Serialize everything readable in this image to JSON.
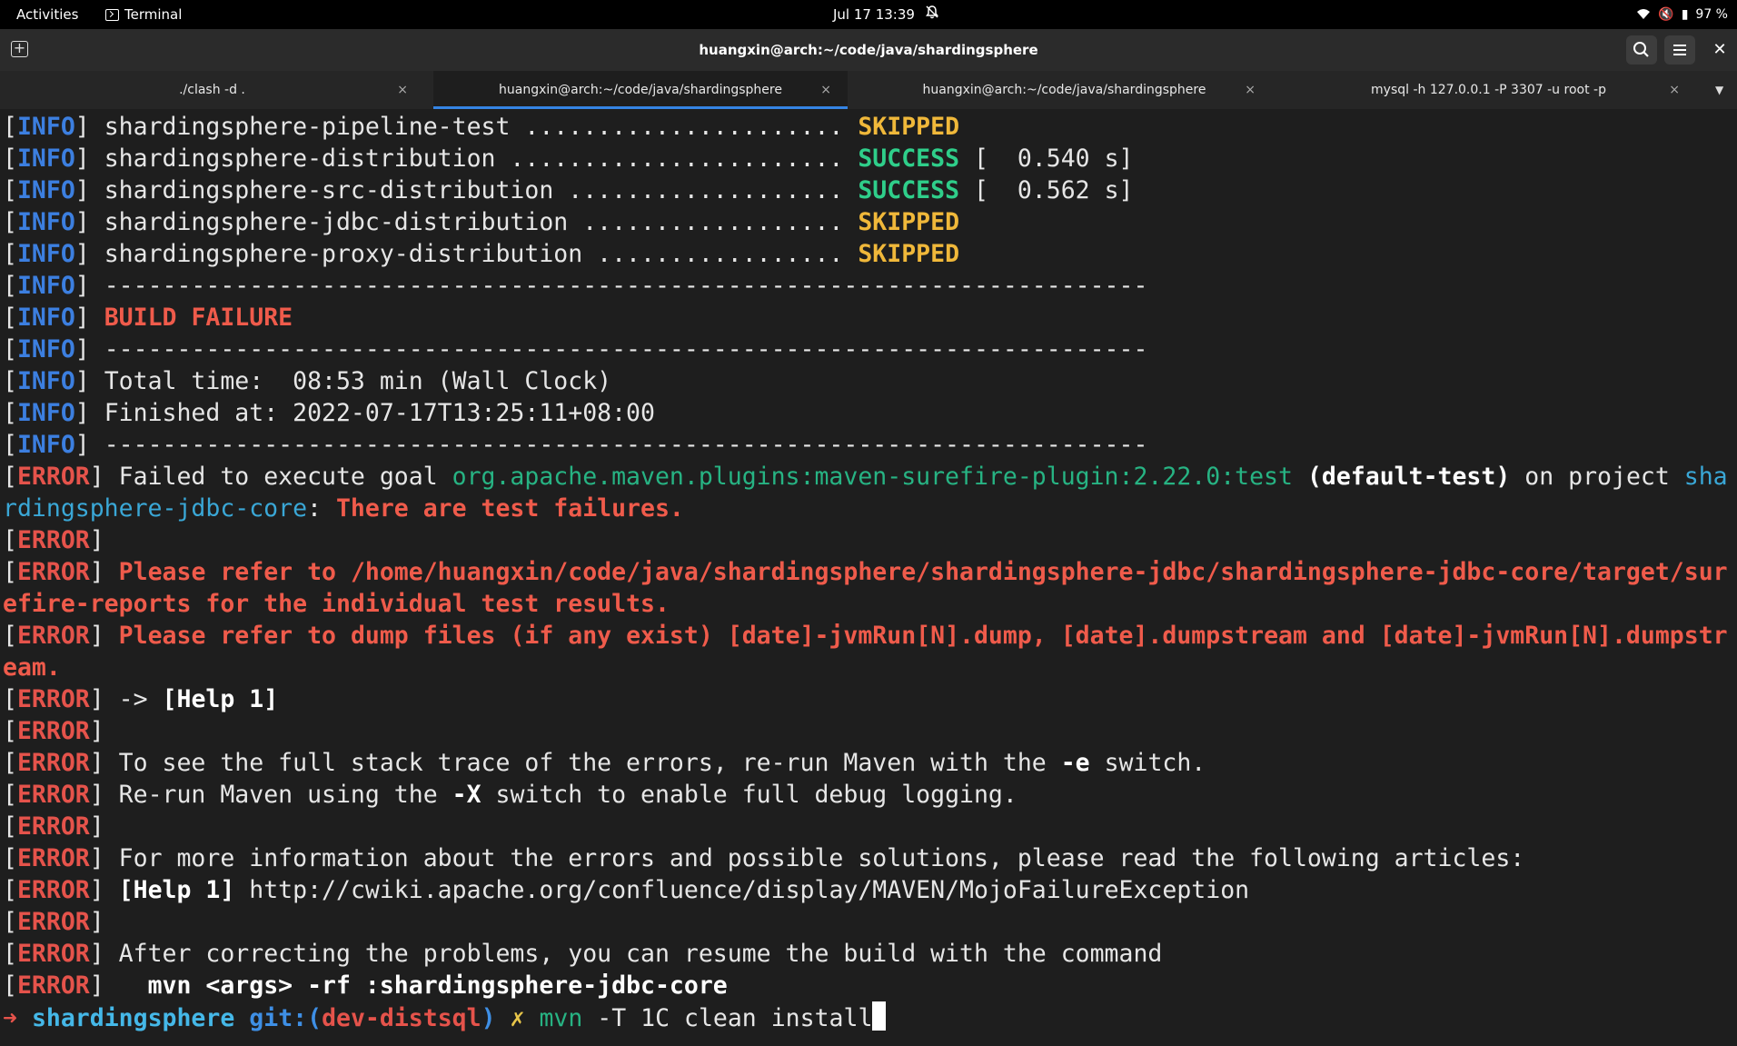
{
  "topbar": {
    "activities": "Activities",
    "app_name": "Terminal",
    "datetime": "Jul 17  13:39",
    "battery": "97 %"
  },
  "window": {
    "title": "huangxin@arch:~/code/java/shardingsphere"
  },
  "tabs": [
    {
      "label": "./clash -d ."
    },
    {
      "label": "huangxin@arch:~/code/java/shardingsphere"
    },
    {
      "label": "huangxin@arch:~/code/java/shardingsphere"
    },
    {
      "label": "mysql -h 127.0.0.1 -P 3307 -u root -p"
    }
  ],
  "tab_close": "×",
  "colors": {
    "info": "#3c7fe0",
    "error": "#e5534b",
    "success": "#2fce8a",
    "skipped": "#f0b83a",
    "accent": "#3584e4"
  },
  "terminal": {
    "lines": [
      {
        "s": [
          {
            "t": "[",
            "c": "br"
          },
          {
            "t": "INFO",
            "c": "info"
          },
          {
            "t": "] shardingsphere-pipeline-test ...................... "
          },
          {
            "t": "SKIPPED",
            "c": "skip"
          }
        ]
      },
      {
        "s": [
          {
            "t": "[",
            "c": "br"
          },
          {
            "t": "INFO",
            "c": "info"
          },
          {
            "t": "] shardingsphere-distribution ....................... "
          },
          {
            "t": "SUCCESS",
            "c": "succ"
          },
          {
            "t": " [  0.540 s]"
          }
        ]
      },
      {
        "s": [
          {
            "t": "[",
            "c": "br"
          },
          {
            "t": "INFO",
            "c": "info"
          },
          {
            "t": "] shardingsphere-src-distribution ................... "
          },
          {
            "t": "SUCCESS",
            "c": "succ"
          },
          {
            "t": " [  0.562 s]"
          }
        ]
      },
      {
        "s": [
          {
            "t": "[",
            "c": "br"
          },
          {
            "t": "INFO",
            "c": "info"
          },
          {
            "t": "] shardingsphere-jdbc-distribution .................. "
          },
          {
            "t": "SKIPPED",
            "c": "skip"
          }
        ]
      },
      {
        "s": [
          {
            "t": "[",
            "c": "br"
          },
          {
            "t": "INFO",
            "c": "info"
          },
          {
            "t": "] shardingsphere-proxy-distribution ................. "
          },
          {
            "t": "SKIPPED",
            "c": "skip"
          }
        ]
      },
      {
        "s": [
          {
            "t": "[",
            "c": "br"
          },
          {
            "t": "INFO",
            "c": "info"
          },
          {
            "t": "] ------------------------------------------------------------------------"
          }
        ]
      },
      {
        "s": [
          {
            "t": "[",
            "c": "br"
          },
          {
            "t": "INFO",
            "c": "info"
          },
          {
            "t": "] "
          },
          {
            "t": "BUILD FAILURE",
            "c": "red"
          }
        ]
      },
      {
        "s": [
          {
            "t": "[",
            "c": "br"
          },
          {
            "t": "INFO",
            "c": "info"
          },
          {
            "t": "] ------------------------------------------------------------------------"
          }
        ]
      },
      {
        "s": [
          {
            "t": "[",
            "c": "br"
          },
          {
            "t": "INFO",
            "c": "info"
          },
          {
            "t": "] Total time:  08:53 min (Wall Clock)"
          }
        ]
      },
      {
        "s": [
          {
            "t": "[",
            "c": "br"
          },
          {
            "t": "INFO",
            "c": "info"
          },
          {
            "t": "] Finished at: 2022-07-17T13:25:11+08:00"
          }
        ]
      },
      {
        "s": [
          {
            "t": "[",
            "c": "br"
          },
          {
            "t": "INFO",
            "c": "info"
          },
          {
            "t": "] ------------------------------------------------------------------------"
          }
        ]
      },
      {
        "s": [
          {
            "t": "[",
            "c": "br"
          },
          {
            "t": "ERROR",
            "c": "err"
          },
          {
            "t": "] Failed to execute goal "
          },
          {
            "t": "org.apache.maven.plugins:maven-surefire-plugin:2.22.0:test",
            "c": "green"
          },
          {
            "t": " "
          },
          {
            "t": "(default-test)",
            "c": "white"
          },
          {
            "t": " on project "
          },
          {
            "t": "sha",
            "c": "cyan"
          }
        ]
      },
      {
        "s": [
          {
            "t": "rdingsphere-jdbc-core",
            "c": "cyan"
          },
          {
            "t": ": "
          },
          {
            "t": "There are test failures.",
            "c": "red"
          }
        ]
      },
      {
        "s": [
          {
            "t": "[",
            "c": "br"
          },
          {
            "t": "ERROR",
            "c": "err"
          },
          {
            "t": "]"
          }
        ]
      },
      {
        "s": [
          {
            "t": "[",
            "c": "br"
          },
          {
            "t": "ERROR",
            "c": "err"
          },
          {
            "t": "] "
          },
          {
            "t": "Please refer to /home/huangxin/code/java/shardingsphere/shardingsphere-jdbc/shardingsphere-jdbc-core/target/sur",
            "c": "red"
          }
        ]
      },
      {
        "s": [
          {
            "t": "efire-reports for the individual test results.",
            "c": "red"
          }
        ]
      },
      {
        "s": [
          {
            "t": "[",
            "c": "br"
          },
          {
            "t": "ERROR",
            "c": "err"
          },
          {
            "t": "] "
          },
          {
            "t": "Please refer to dump files (if any exist) [date]-jvmRun[N].dump, [date].dumpstream and [date]-jvmRun[N].dumpstr",
            "c": "red"
          }
        ]
      },
      {
        "s": [
          {
            "t": "eam.",
            "c": "red"
          }
        ]
      },
      {
        "s": [
          {
            "t": "[",
            "c": "br"
          },
          {
            "t": "ERROR",
            "c": "err"
          },
          {
            "t": "] -> "
          },
          {
            "t": "[Help 1]",
            "c": "white"
          }
        ]
      },
      {
        "s": [
          {
            "t": "[",
            "c": "br"
          },
          {
            "t": "ERROR",
            "c": "err"
          },
          {
            "t": "]"
          }
        ]
      },
      {
        "s": [
          {
            "t": "[",
            "c": "br"
          },
          {
            "t": "ERROR",
            "c": "err"
          },
          {
            "t": "] To see the full stack trace of the errors, re-run Maven with the "
          },
          {
            "t": "-e",
            "c": "white"
          },
          {
            "t": " switch."
          }
        ]
      },
      {
        "s": [
          {
            "t": "[",
            "c": "br"
          },
          {
            "t": "ERROR",
            "c": "err"
          },
          {
            "t": "] Re-run Maven using the "
          },
          {
            "t": "-X",
            "c": "white"
          },
          {
            "t": " switch to enable full debug logging."
          }
        ]
      },
      {
        "s": [
          {
            "t": "[",
            "c": "br"
          },
          {
            "t": "ERROR",
            "c": "err"
          },
          {
            "t": "]"
          }
        ]
      },
      {
        "s": [
          {
            "t": "[",
            "c": "br"
          },
          {
            "t": "ERROR",
            "c": "err"
          },
          {
            "t": "] For more information about the errors and possible solutions, please read the following articles:"
          }
        ]
      },
      {
        "s": [
          {
            "t": "[",
            "c": "br"
          },
          {
            "t": "ERROR",
            "c": "err"
          },
          {
            "t": "] "
          },
          {
            "t": "[Help 1]",
            "c": "white"
          },
          {
            "t": " http://cwiki.apache.org/confluence/display/MAVEN/MojoFailureException"
          }
        ]
      },
      {
        "s": [
          {
            "t": "[",
            "c": "br"
          },
          {
            "t": "ERROR",
            "c": "err"
          },
          {
            "t": "]"
          }
        ]
      },
      {
        "s": [
          {
            "t": "[",
            "c": "br"
          },
          {
            "t": "ERROR",
            "c": "err"
          },
          {
            "t": "] After correcting the problems, you can resume the build with the command"
          }
        ]
      },
      {
        "s": [
          {
            "t": "[",
            "c": "br"
          },
          {
            "t": "ERROR",
            "c": "err"
          },
          {
            "t": "]   "
          },
          {
            "t": "mvn <args> -rf :shardingsphere-jdbc-core",
            "c": "white"
          }
        ]
      }
    ],
    "prompt": {
      "arrow": "➜",
      "dir": "shardingsphere",
      "git": "git:(",
      "branch": "dev-distsql",
      "git_close": ")",
      "dirty": "✗",
      "cmd": "mvn",
      "args": " -T 1C clean install"
    }
  }
}
